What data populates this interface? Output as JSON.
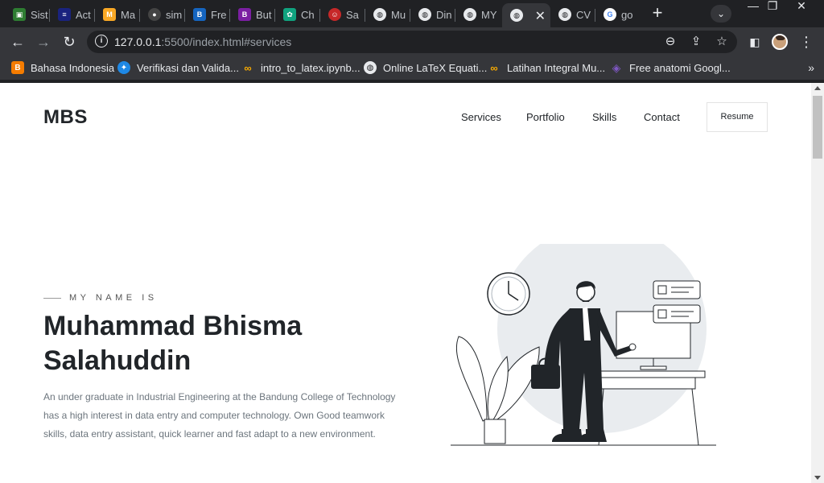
{
  "browser": {
    "tabs": [
      {
        "label": "Sist",
        "icon": "app-icon",
        "color": "#2e7d32"
      },
      {
        "label": "Act",
        "icon": "kominfo-icon",
        "color": "#1a237e"
      },
      {
        "label": "Ma",
        "icon": "m-app-icon",
        "color": "#f9a825"
      },
      {
        "label": "sim",
        "icon": "github-icon",
        "color": "#444444"
      },
      {
        "label": "Fre",
        "icon": "bootstrap-icon",
        "color": "#1565c0"
      },
      {
        "label": "But",
        "icon": "bootstrap-icon",
        "color": "#7b1fa2"
      },
      {
        "label": "Ch",
        "icon": "chatgpt-icon",
        "color": "#10a37f"
      },
      {
        "label": "Sa",
        "icon": "avatar-icon",
        "color": "#c62828"
      },
      {
        "label": "Mu",
        "icon": "globe-icon",
        "color": "#e8eaed"
      },
      {
        "label": "Din",
        "icon": "globe-icon",
        "color": "#e8eaed"
      },
      {
        "label": "MY",
        "icon": "globe-icon",
        "color": "#e8eaed"
      },
      {
        "label": "",
        "icon": "globe-icon",
        "color": "#e8eaed",
        "active": true
      },
      {
        "label": "CV",
        "icon": "globe-icon",
        "color": "#e8eaed"
      },
      {
        "label": "go",
        "icon": "google-icon",
        "color": "#4285f4"
      }
    ],
    "url_host": "127.0.0.1",
    "url_rest": ":5500/index.html#services",
    "bookmarks": [
      {
        "label": "Bahasa Indonesia",
        "icon": "blogger-icon",
        "color": "#f57c00"
      },
      {
        "label": "Verifikasi dan Valida...",
        "icon": "kemdikbud-icon",
        "color": "#1e88e5"
      },
      {
        "label": "intro_to_latex.ipynb...",
        "icon": "colab-icon",
        "color": "#f9ab00"
      },
      {
        "label": "Online LaTeX Equati...",
        "icon": "globe-icon",
        "color": "#e8eaed"
      },
      {
        "label": "Latihan Integral Mu...",
        "icon": "colab-icon",
        "color": "#f9ab00"
      },
      {
        "label": "Free anatomi Googl...",
        "icon": "slides-icon",
        "color": "#7e57c2"
      }
    ]
  },
  "site": {
    "brand": "MBS",
    "nav": [
      "Services",
      "Portfolio",
      "Skills",
      "Contact"
    ],
    "resume_label": "Resume",
    "eyebrow": "MY NAME IS",
    "name_line1": "Muhammad Bhisma",
    "name_line2": "Salahuddin",
    "description": "An under graduate in Industrial Engineering at the Bandung College of Technology has a high interest in data entry and computer technology. Own Good teamwork skills, data entry assistant, quick learner and fast adapt to a new environment."
  }
}
